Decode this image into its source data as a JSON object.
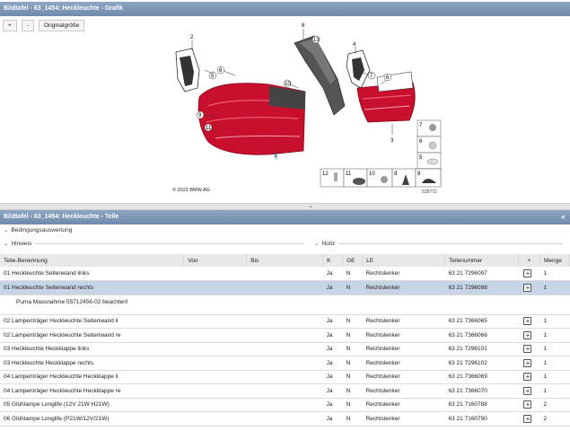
{
  "top_panel": {
    "title": "Bildtafel - 63_1454: Heckleuchte - Grafik",
    "btn_plus": "+",
    "btn_minus": "-",
    "btn_original": "Originalgröße",
    "copyright": "© 2022 BMW AG",
    "diagram_id": "528772",
    "callouts": [
      "1",
      "2",
      "3",
      "4",
      "5",
      "6",
      "7",
      "8",
      "9",
      "10",
      "11",
      "12",
      "13"
    ],
    "legend_numbers": [
      "7",
      "6",
      "5",
      "12",
      "11",
      "10",
      "9",
      "8"
    ]
  },
  "bottom_panel": {
    "title": "Bildtafel - 63_1454: Heckleuchte - Teile",
    "collapse_icon": "«",
    "bedingung": "Bedingungsauswertung",
    "hinweis": "Hinweis",
    "notiz": "Notiz"
  },
  "table": {
    "headers": [
      "Teile-Benennung",
      "Von",
      "Bis",
      "K",
      "GE",
      "LE",
      "Teilenummer",
      "+",
      "Menge"
    ],
    "rows": [
      {
        "name": "01 Heckleuchte Seitenwand links",
        "k": "Ja",
        "ge": "N",
        "le": "Rechtslenker",
        "nr": "63 21 7296097",
        "qty": "1"
      },
      {
        "name": "01 Heckleuchte Seitenwand rechts",
        "k": "Ja",
        "ge": "N",
        "le": "Rechtslenker",
        "nr": "63 21 7296098",
        "qty": "1"
      },
      {
        "note": "Puma Massnahme 55712456-02 beachten!"
      },
      {
        "name": "02 Lampenträger Heckleuchte Seitenwand li",
        "k": "Ja",
        "ge": "N",
        "le": "Rechtslenker",
        "nr": "63 21 7366065",
        "qty": "1"
      },
      {
        "name": "02 Lampenträger Heckleuchte Seitenwand re",
        "k": "Ja",
        "ge": "N",
        "le": "Rechtslenker",
        "nr": "63 21 7366066",
        "qty": "1"
      },
      {
        "name": "03 Heckleuchte Heckklappe links",
        "k": "Ja",
        "ge": "N",
        "le": "Rechtslenker",
        "nr": "63 21 7296101",
        "qty": "1"
      },
      {
        "name": "03 Heckleuchte Heckklappe rechts",
        "k": "Ja",
        "ge": "N",
        "le": "Rechtslenker",
        "nr": "63 21 7296102",
        "qty": "1"
      },
      {
        "name": "04 Lampenträger Heckleuchte Heckklappe li",
        "k": "Ja",
        "ge": "N",
        "le": "Rechtslenker",
        "nr": "63 21 7366069",
        "qty": "1"
      },
      {
        "name": "04 Lampenträger Heckleuchte Heckklappe re",
        "k": "Ja",
        "ge": "N",
        "le": "Rechtslenker",
        "nr": "63 21 7366070",
        "qty": "1"
      },
      {
        "name": "05 Glühlampe Longlife (12V 21W H21W)",
        "k": "Ja",
        "ge": "N",
        "le": "Rechtslenker",
        "nr": "63 21 7160788",
        "qty": "2"
      },
      {
        "name": "06 Glühlampe Longlife (P21W/12V/21W)",
        "k": "Ja",
        "ge": "N",
        "le": "Rechtslenker",
        "nr": "63 21 7160790",
        "qty": "2"
      }
    ]
  },
  "colors": {
    "titlebar": "#7b93b3",
    "selected_row": "#c6d4e6",
    "lamp_red": "#c8102e"
  }
}
